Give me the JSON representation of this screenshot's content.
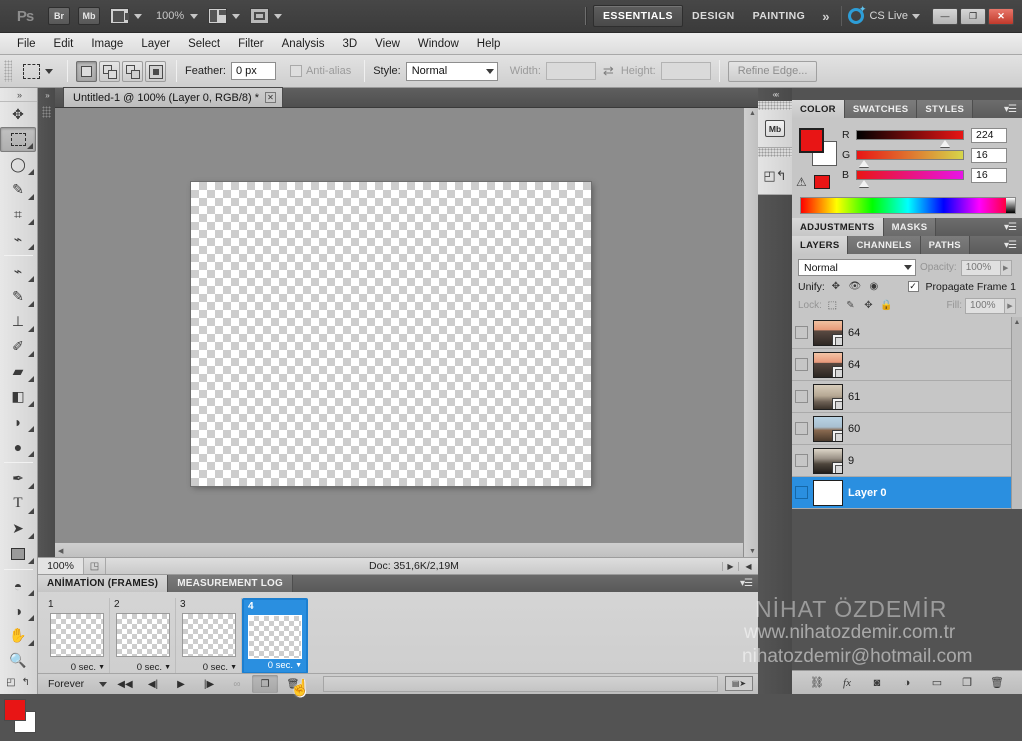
{
  "titlebar": {
    "logo": "Ps",
    "bridge_label": "Br",
    "minibridge_label": "Mb",
    "zoom_level": "100%",
    "workspaces": [
      {
        "label": "ESSENTIALS",
        "active": true
      },
      {
        "label": "DESIGN",
        "active": false
      },
      {
        "label": "PAINTING",
        "active": false
      }
    ],
    "more_workspaces": "»",
    "cslive_label": "CS Live",
    "window_buttons": {
      "minimize": "—",
      "maximize": "❐",
      "close": "✕"
    }
  },
  "menubar": {
    "items": [
      "File",
      "Edit",
      "Image",
      "Layer",
      "Select",
      "Filter",
      "Analysis",
      "3D",
      "View",
      "Window",
      "Help"
    ]
  },
  "optionsbar": {
    "feather_label": "Feather:",
    "feather_value": "0 px",
    "antialias_label": "Anti-alias",
    "style_label": "Style:",
    "style_value": "Normal",
    "width_label": "Width:",
    "width_value": "",
    "height_label": "Height:",
    "height_value": "",
    "swap_icon": "⇄",
    "refine_edge_label": "Refine Edge..."
  },
  "toolbar": {
    "tools_top": [
      {
        "name": "move-tool",
        "glyph": "✥"
      },
      {
        "name": "rectangular-marquee-tool",
        "glyph": "",
        "selected": true
      },
      {
        "name": "lasso-tool",
        "glyph": "◯"
      },
      {
        "name": "quick-selection-tool",
        "glyph": "✎"
      },
      {
        "name": "crop-tool",
        "glyph": "⌗"
      },
      {
        "name": "eyedropper-tool",
        "glyph": "⌁"
      }
    ],
    "tools_retouch": [
      {
        "name": "spot-healing-brush-tool",
        "glyph": "⌁"
      },
      {
        "name": "brush-tool",
        "glyph": "✎"
      },
      {
        "name": "clone-stamp-tool",
        "glyph": "⊥"
      },
      {
        "name": "history-brush-tool",
        "glyph": "✐"
      },
      {
        "name": "eraser-tool",
        "glyph": "▰"
      },
      {
        "name": "gradient-tool",
        "glyph": "◧"
      },
      {
        "name": "blur-tool",
        "glyph": "◗"
      },
      {
        "name": "dodge-tool",
        "glyph": "●"
      }
    ],
    "tools_vector": [
      {
        "name": "pen-tool",
        "glyph": "✒"
      },
      {
        "name": "type-tool",
        "glyph": "T"
      },
      {
        "name": "path-selection-tool",
        "glyph": "➤"
      },
      {
        "name": "rectangle-tool",
        "glyph": "▭"
      }
    ],
    "tools_3d": [
      {
        "name": "3d-object-rotate-tool",
        "glyph": "◓"
      },
      {
        "name": "3d-camera-orbit-tool",
        "glyph": "◑"
      },
      {
        "name": "hand-tool",
        "glyph": "✋"
      },
      {
        "name": "zoom-tool",
        "glyph": "🔍"
      }
    ],
    "foreground_color": "#e81515",
    "background_color": "#ffffff"
  },
  "document": {
    "tab_title": "Untitled-1 @ 100% (Layer 0, RGB/8) *",
    "close_glyph": "✕"
  },
  "statusbar": {
    "zoom": "100%",
    "doc_info": "Doc: 351,6K/2,19M"
  },
  "animation": {
    "tabs": [
      {
        "label": "ANİMATİON (FRAMES)",
        "active": true
      },
      {
        "label": "MEASUREMENT LOG",
        "active": false
      }
    ],
    "frames": [
      {
        "number": "1",
        "delay": "0 sec.",
        "selected": false
      },
      {
        "number": "2",
        "delay": "0 sec.",
        "selected": false
      },
      {
        "number": "3",
        "delay": "0 sec.",
        "selected": false
      },
      {
        "number": "4",
        "delay": "0 sec.",
        "selected": true
      }
    ],
    "loop_value": "Forever",
    "controls": [
      {
        "name": "select-first-frame-button",
        "glyph": "◀◀"
      },
      {
        "name": "select-previous-frame-button",
        "glyph": "◀|"
      },
      {
        "name": "play-animation-button",
        "glyph": "▶"
      },
      {
        "name": "select-next-frame-button",
        "glyph": "|▶"
      },
      {
        "name": "tween-frames-button",
        "glyph": "∞"
      },
      {
        "name": "duplicate-frame-button",
        "glyph": "❐"
      },
      {
        "name": "delete-frame-button",
        "glyph": "🗑"
      }
    ]
  },
  "color_panel": {
    "tabs": [
      {
        "label": "COLOR",
        "active": true
      },
      {
        "label": "SWATCHES",
        "active": false
      },
      {
        "label": "STYLES",
        "active": false
      }
    ],
    "channels": [
      {
        "label": "R",
        "value": "224"
      },
      {
        "label": "G",
        "value": "16"
      },
      {
        "label": "B",
        "value": "16"
      }
    ],
    "warning_glyph": "⚠",
    "foreground": "#e81515"
  },
  "adjustments_panel": {
    "tabs": [
      {
        "label": "ADJUSTMENTS",
        "active": true
      },
      {
        "label": "MASKS",
        "active": false
      }
    ]
  },
  "layers_panel": {
    "tabs": [
      {
        "label": "LAYERS",
        "active": true
      },
      {
        "label": "CHANNELS",
        "active": false
      },
      {
        "label": "PATHS",
        "active": false
      }
    ],
    "blend_mode": "Normal",
    "opacity_label": "Opacity:",
    "opacity_value": "100%",
    "unify_label": "Unify:",
    "propagate_label": "Propagate Frame 1",
    "propagate_checked": true,
    "check_glyph": "✓",
    "lock_label": "Lock:",
    "fill_label": "Fill:",
    "fill_value": "100%",
    "layers": [
      {
        "name": "64",
        "selected": false,
        "kind": "image"
      },
      {
        "name": "64",
        "selected": false,
        "kind": "image"
      },
      {
        "name": "61",
        "selected": false,
        "kind": "image"
      },
      {
        "name": "60",
        "selected": false,
        "kind": "image"
      },
      {
        "name": "9",
        "selected": false,
        "kind": "image"
      },
      {
        "name": "Layer 0",
        "selected": true,
        "kind": "white"
      }
    ],
    "bottom_icons": [
      {
        "name": "link-layers-icon",
        "glyph": "⛓"
      },
      {
        "name": "layer-style-icon",
        "glyph": "fx"
      },
      {
        "name": "layer-mask-icon",
        "glyph": "◙"
      },
      {
        "name": "adjustment-layer-icon",
        "glyph": "◑"
      },
      {
        "name": "new-group-icon",
        "glyph": "▭"
      },
      {
        "name": "new-layer-icon",
        "glyph": "❐"
      },
      {
        "name": "delete-layer-icon",
        "glyph": "🗑"
      }
    ]
  },
  "minidock": {
    "minibridge_label": "Mb"
  },
  "watermark": {
    "line1": "NİHAT ÖZDEMİR",
    "line2": "www.nihatozdemir.com.tr",
    "line3": "nihatozdemir@hotmail.com"
  }
}
